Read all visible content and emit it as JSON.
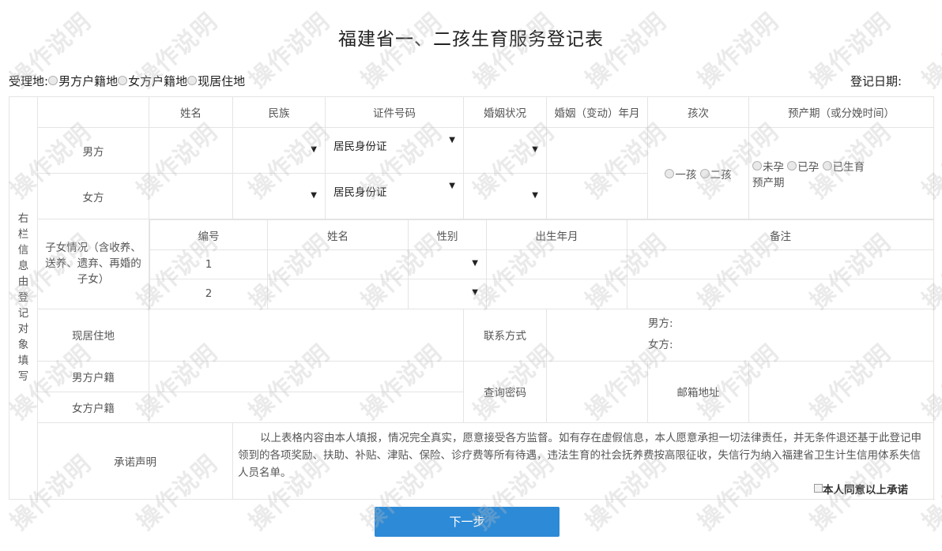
{
  "title": "福建省一、二孩生育服务登记表",
  "acceptance": {
    "label": "受理地:",
    "options": [
      "男方户籍地",
      "女方户籍地",
      "现居住地"
    ],
    "date_label": "登记日期:"
  },
  "sidebar_label": "右栏信息由登记对象填写",
  "header": {
    "name": "姓名",
    "ethnicity": "民族",
    "id_number": "证件号码",
    "marital_status": "婚姻状况",
    "marriage_date": "婚姻（变动）年月",
    "child_order": "孩次",
    "due_date": "预产期（或分娩时间）"
  },
  "male": {
    "label": "男方",
    "id_type": "居民身份证"
  },
  "female": {
    "label": "女方",
    "id_type": "居民身份证"
  },
  "child_order_options": [
    "一孩",
    "二孩"
  ],
  "pregnancy_options": [
    "未孕",
    "已孕",
    "已生育"
  ],
  "due_date_label": "预产期",
  "children": {
    "label": "子女情况（含收养、送养、遗弃、再婚的子女）",
    "headers": [
      "编号",
      "姓名",
      "性别",
      "出生年月",
      "备注"
    ],
    "rows": [
      {
        "no": "1"
      },
      {
        "no": "2"
      }
    ]
  },
  "address_label": "现居住地",
  "contact": {
    "label": "联系方式",
    "male": "男方:",
    "female": "女方:"
  },
  "household": {
    "male": "男方户籍",
    "female": "女方户籍"
  },
  "query_password": "查询密码",
  "email_address": "邮箱地址",
  "promise": {
    "label": "承诺声明",
    "text": "以上表格内容由本人填报，情况完全真实，愿意接受各方监督。如有存在虚假信息，本人愿意承担一切法律责任，并无条件退还基于此登记申领到的各项奖励、扶助、补贴、津贴、保险、诊疗费等所有待遇，违法生育的社会抚养费按高限征收，失信行为纳入福建省卫生计生信用体系失信人员名单。",
    "agree": "本人同意以上承诺"
  },
  "next_button": "下一步",
  "watermark": "操作说明"
}
